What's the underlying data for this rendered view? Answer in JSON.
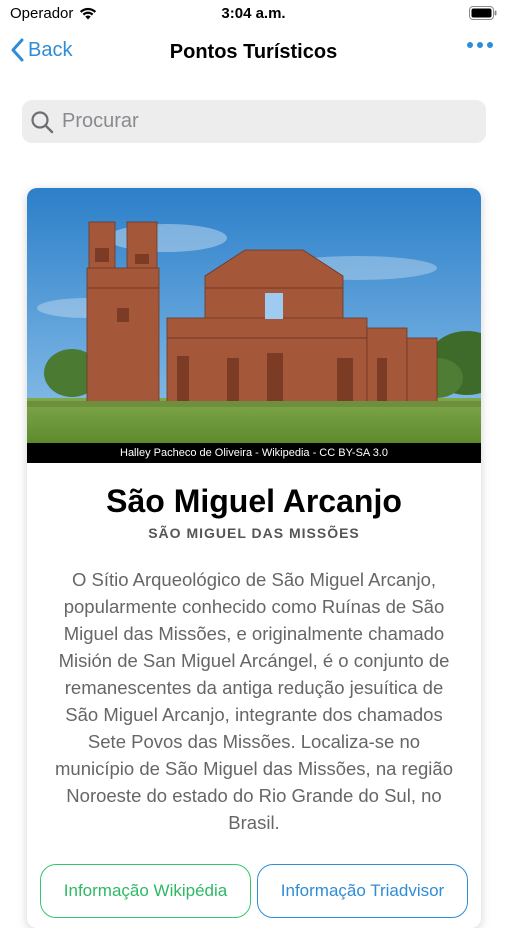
{
  "status_bar": {
    "carrier": "Operador",
    "time": "3:04 a.m."
  },
  "nav": {
    "back_label": "Back",
    "title": "Pontos Turísticos"
  },
  "search": {
    "placeholder": "Procurar"
  },
  "card": {
    "photo_credit": "Halley Pacheco de Oliveira - Wikipedia - CC BY-SA 3.0",
    "name": "São Miguel Arcanjo",
    "subtitle": "SÃO MIGUEL DAS MISSÕES",
    "description": "O Sítio Arqueológico de São Miguel Arcanjo, popularmente conhecido como Ruínas de São Miguel das Missões, e originalmente chamado Misión de San Miguel Arcángel, é o conjunto de remanescentes da antiga redução jesuítica de São Miguel Arcanjo, integrante dos chamados Sete Povos das Missões. Localiza-se no município de São Miguel das Missões, na região Noroeste do estado do Rio Grande do Sul, no Brasil.",
    "buttons": {
      "wikipedia": "Informação Wikipédia",
      "tripadvisor": "Informação Triadvisor"
    }
  },
  "colors": {
    "accent": "#2f8cd6",
    "wiki_green": "#2fb864"
  }
}
